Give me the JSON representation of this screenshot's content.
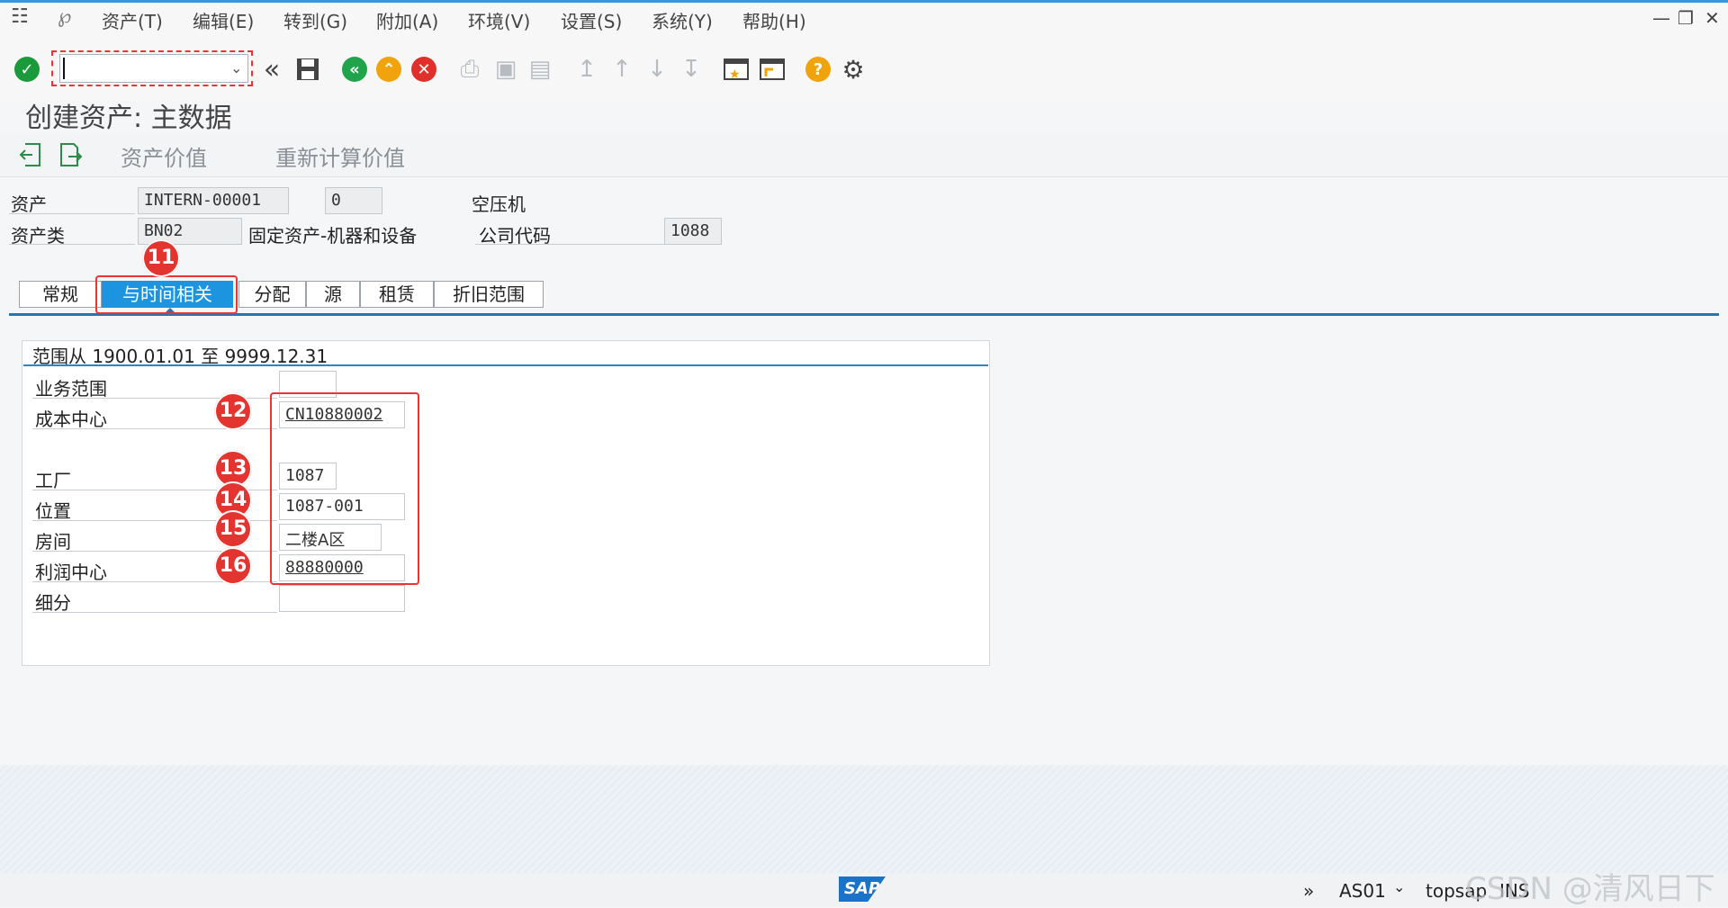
{
  "menu": {
    "items": [
      "资产(T)",
      "编辑(E)",
      "转到(G)",
      "附加(A)",
      "环境(V)",
      "设置(S)",
      "系统(Y)",
      "帮助(H)"
    ]
  },
  "toolbar": {
    "command_field_value": "",
    "icons": [
      "check-icon",
      "back-double-icon",
      "save-icon",
      "back-icon",
      "exit-icon",
      "cancel-icon",
      "print-icon",
      "find-icon",
      "find-next-icon",
      "first-page-icon",
      "prev-page-icon",
      "next-page-icon",
      "last-page-icon",
      "new-session-icon",
      "shortcut-icon",
      "help-icon",
      "settings-icon"
    ]
  },
  "page": {
    "title": "创建资产:  主数据",
    "app_links": {
      "asset_value": "资产价值",
      "recalc_value": "重新计算价值"
    }
  },
  "header": {
    "asset_label": "资产",
    "asset_number": "INTERN-00001",
    "sub_number": "0",
    "asset_description": "空压机",
    "asset_class_label": "资产类",
    "asset_class": "BN02",
    "asset_class_text": "固定资产-机器和设备",
    "company_code_label": "公司代码",
    "company_code": "1088"
  },
  "tabs": [
    {
      "label": "常规",
      "active": false
    },
    {
      "label": "与时间相关",
      "active": true
    },
    {
      "label": "分配",
      "active": false
    },
    {
      "label": "源",
      "active": false
    },
    {
      "label": "租赁",
      "active": false
    },
    {
      "label": "折旧范围",
      "active": false
    }
  ],
  "time_dependent": {
    "range_label": "范围从 1900.01.01 至 9999.12.31",
    "rows": [
      {
        "label": "业务范围",
        "value": ""
      },
      {
        "label": "成本中心",
        "value": "CN10880002"
      },
      {
        "label": "工厂",
        "value": "1087"
      },
      {
        "label": "位置",
        "value": "1087-001"
      },
      {
        "label": "房间",
        "value": "二楼A区"
      },
      {
        "label": "利润中心",
        "value": "88880000"
      },
      {
        "label": "细分",
        "value": ""
      }
    ]
  },
  "annotations": [
    "11",
    "12",
    "13",
    "14",
    "15",
    "16"
  ],
  "statusbar": {
    "logo": "SAP",
    "transaction": "AS01",
    "server": "topsap",
    "mode": "INS",
    "watermark": "CSDN @清风日下"
  },
  "colors": {
    "accent": "#1d94e0",
    "annotation": "#e3342f",
    "ok_green": "#1a9a3a",
    "back_green": "#21a34b",
    "exit_orange": "#f0a30a",
    "cancel_red": "#e0302b"
  }
}
